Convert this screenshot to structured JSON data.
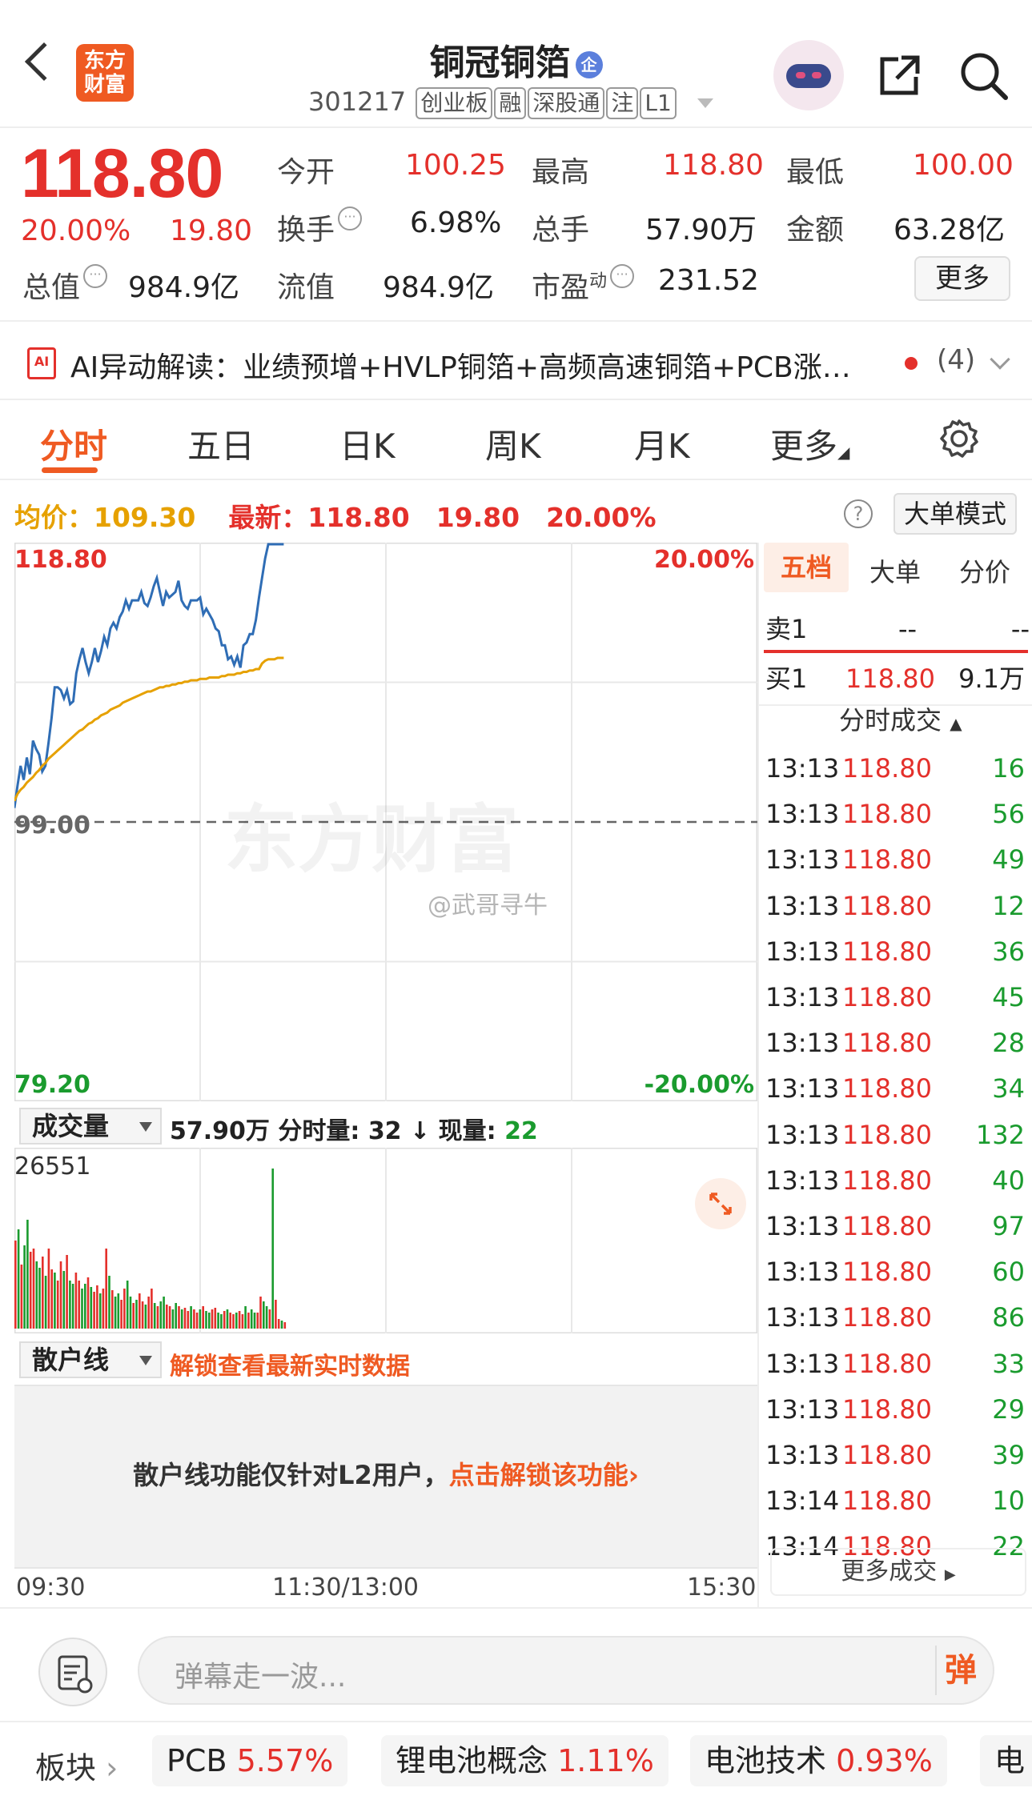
{
  "header": {
    "logo_line1": "东方",
    "logo_line2": "财富",
    "stock_name": "铜冠铜箔",
    "ent_badge": "企",
    "stock_code": "301217",
    "tags": [
      "创业板",
      "融",
      "深股通",
      "注",
      "L1"
    ]
  },
  "quote": {
    "price": "118.80",
    "change_pct": "20.00%",
    "change_amt": "19.80",
    "open_label": "今开",
    "open": "100.25",
    "high_label": "最高",
    "high": "118.80",
    "low_label": "最低",
    "low": "100.00",
    "turnover_label": "换手",
    "turnover": "6.98%",
    "volume_label": "总手",
    "volume": "57.90万",
    "amount_label": "金额",
    "amount": "63.28亿",
    "mktcap_label": "总值",
    "mktcap": "984.9亿",
    "float_label": "流值",
    "float_cap": "984.9亿",
    "pe_label": "市盈",
    "pe_sup": "动",
    "pe": "231.52",
    "more_label": "更多"
  },
  "ai": {
    "prefix": "AI异动解读：",
    "text": "业绩预增+HVLP铜箔+高频高速铜箔+PCB涨…",
    "count": "(4)"
  },
  "tabs": [
    "分时",
    "五日",
    "日K",
    "周K",
    "月K",
    "更多"
  ],
  "avg_row": {
    "avg_label": "均价：",
    "avg": "109.30",
    "latest_label": "最新：",
    "latest": "118.80",
    "chg": "19.80",
    "pct": "20.00%",
    "help": "?",
    "bigmode": "大单模式"
  },
  "chart_data": {
    "type": "line",
    "y_top": "118.80",
    "y_mid": "99.00",
    "y_bottom": "79.20",
    "pct_top": "20.00%",
    "pct_bottom": "-20.00%",
    "ylim": [
      79.2,
      118.8
    ],
    "prev_close": 99.0,
    "series": [
      {
        "values": [
          100.0,
          101.6,
          103.0,
          102.0,
          103.6,
          102.4,
          104.8,
          104.2,
          103.8,
          102.6,
          103.0,
          104.6,
          106.4,
          108.6,
          108.6,
          108.4,
          107.8,
          108.4,
          107.4,
          107.6,
          109.6,
          110.6,
          111.4,
          110.4,
          109.6,
          110.4,
          111.4,
          110.4,
          111.2,
          112.2,
          111.6,
          112.8,
          113.2,
          112.8,
          113.6,
          114.0,
          114.8,
          114.2,
          114.8,
          114.8,
          114.8,
          115.4,
          114.6,
          114.4,
          115.0,
          115.8,
          116.4,
          115.4,
          114.4,
          115.4,
          115.0,
          115.2,
          115.4,
          116.2,
          114.8,
          114.4,
          114.2,
          114.8,
          114.8,
          114.8,
          115.0,
          113.8,
          114.2,
          113.8,
          113.4,
          112.8,
          112.6,
          111.6,
          111.6,
          110.6,
          110.8,
          110.2,
          110.8,
          110.0,
          111.6,
          111.8,
          112.4,
          112.4,
          113.4,
          115.0,
          116.4,
          117.8,
          118.8,
          118.8,
          118.8,
          118.8,
          118.8,
          118.8
        ]
      },
      {
        "values": [
          100.5,
          101.0,
          101.3,
          101.5,
          101.8,
          102.0,
          102.2,
          102.5,
          102.7,
          103.0,
          103.2,
          103.5,
          103.7,
          103.9,
          104.1,
          104.3,
          104.5,
          104.7,
          104.9,
          105.1,
          105.3,
          105.5,
          105.6,
          105.8,
          106.0,
          106.1,
          106.3,
          106.4,
          106.6,
          106.7,
          106.8,
          107.0,
          107.1,
          107.2,
          107.3,
          107.5,
          107.6,
          107.7,
          107.8,
          107.9,
          108.0,
          108.1,
          108.2,
          108.3,
          108.3,
          108.4,
          108.5,
          108.6,
          108.6,
          108.7,
          108.7,
          108.8,
          108.8,
          108.9,
          108.9,
          109.0,
          109.0,
          109.1,
          109.1,
          109.1,
          109.2,
          109.2,
          109.2,
          109.3,
          109.3,
          109.3,
          109.3,
          109.4,
          109.4,
          109.5,
          109.5,
          109.5,
          109.6,
          109.6,
          109.7,
          109.7,
          109.8,
          109.8,
          109.9,
          109.9,
          110.3,
          110.5,
          110.6,
          110.6,
          110.6,
          110.7,
          110.7,
          110.7
        ]
      }
    ],
    "time_labels": [
      "09:30",
      "11:30/13:00",
      "15:30"
    ]
  },
  "volume": {
    "selector": "成交量",
    "total": "57.90万",
    "cur_label": "分时量:",
    "cur": "32",
    "arrow": "↓",
    "now_label": "现量:",
    "now": "22",
    "max": "26551",
    "bars": [
      0.55,
      0.62,
      0.4,
      0.52,
      0.68,
      0.48,
      0.5,
      0.42,
      0.38,
      0.45,
      0.33,
      0.5,
      0.37,
      0.35,
      0.3,
      0.42,
      0.36,
      0.46,
      0.3,
      0.28,
      0.35,
      0.3,
      0.25,
      0.28,
      0.32,
      0.26,
      0.23,
      0.27,
      0.22,
      0.25,
      0.5,
      0.33,
      0.24,
      0.2,
      0.22,
      0.18,
      0.25,
      0.3,
      0.2,
      0.16,
      0.18,
      0.22,
      0.17,
      0.15,
      0.2,
      0.25,
      0.16,
      0.14,
      0.17,
      0.2,
      0.15,
      0.14,
      0.12,
      0.16,
      0.14,
      0.12,
      0.13,
      0.11,
      0.14,
      0.12,
      0.1,
      0.12,
      0.14,
      0.11,
      0.1,
      0.12,
      0.13,
      0.1,
      0.09,
      0.11,
      0.12,
      0.1,
      0.09,
      0.1,
      0.11,
      0.09,
      0.14,
      0.1,
      0.12,
      0.1,
      0.1,
      0.2,
      0.17,
      0.14,
      0.12,
      1.0,
      0.18,
      0.06,
      0.05,
      0.04
    ]
  },
  "sanhu": {
    "selector": "散户线",
    "unlock_link": "解锁查看最新实时数据",
    "msg_prefix": "散户线功能仅针对L2用户，",
    "msg_link": "点击解锁该功能›"
  },
  "right_panel": {
    "tabs": [
      "五档",
      "大单",
      "分价"
    ],
    "sell1_label": "卖1",
    "sell1_price": "--",
    "sell1_vol": "--",
    "buy1_label": "买1",
    "buy1_price": "118.80",
    "buy1_vol": "9.1万",
    "ticks_title": "分时成交",
    "ticks": [
      {
        "t": "13:13",
        "p": "118.80",
        "v": "16"
      },
      {
        "t": "13:13",
        "p": "118.80",
        "v": "56"
      },
      {
        "t": "13:13",
        "p": "118.80",
        "v": "49"
      },
      {
        "t": "13:13",
        "p": "118.80",
        "v": "12"
      },
      {
        "t": "13:13",
        "p": "118.80",
        "v": "36"
      },
      {
        "t": "13:13",
        "p": "118.80",
        "v": "45"
      },
      {
        "t": "13:13",
        "p": "118.80",
        "v": "28"
      },
      {
        "t": "13:13",
        "p": "118.80",
        "v": "34"
      },
      {
        "t": "13:13",
        "p": "118.80",
        "v": "132"
      },
      {
        "t": "13:13",
        "p": "118.80",
        "v": "40"
      },
      {
        "t": "13:13",
        "p": "118.80",
        "v": "97"
      },
      {
        "t": "13:13",
        "p": "118.80",
        "v": "60"
      },
      {
        "t": "13:13",
        "p": "118.80",
        "v": "86"
      },
      {
        "t": "13:13",
        "p": "118.80",
        "v": "33"
      },
      {
        "t": "13:13",
        "p": "118.80",
        "v": "29"
      },
      {
        "t": "13:13",
        "p": "118.80",
        "v": "39"
      },
      {
        "t": "13:14",
        "p": "118.80",
        "v": "10"
      },
      {
        "t": "13:14",
        "p": "118.80",
        "v": "22"
      }
    ],
    "more_ticks": "更多成交"
  },
  "watermark": "东方财富",
  "weibo": "@武哥寻牛",
  "danmu": {
    "placeholder": "弹幕走一波...",
    "btn": "弹"
  },
  "sectors": {
    "label": "板块",
    "items": [
      {
        "name": "PCB",
        "pct": "5.57%"
      },
      {
        "name": "锂电池概念",
        "pct": "1.11%"
      },
      {
        "name": "电池技术",
        "pct": "0.93%"
      },
      {
        "name": "电",
        "pct": ""
      }
    ]
  },
  "colors": {
    "up": "#e4302b",
    "down": "#1a9b2e",
    "avg": "#e6a100",
    "price_line": "#2f6db5",
    "accent": "#ef5a22"
  }
}
